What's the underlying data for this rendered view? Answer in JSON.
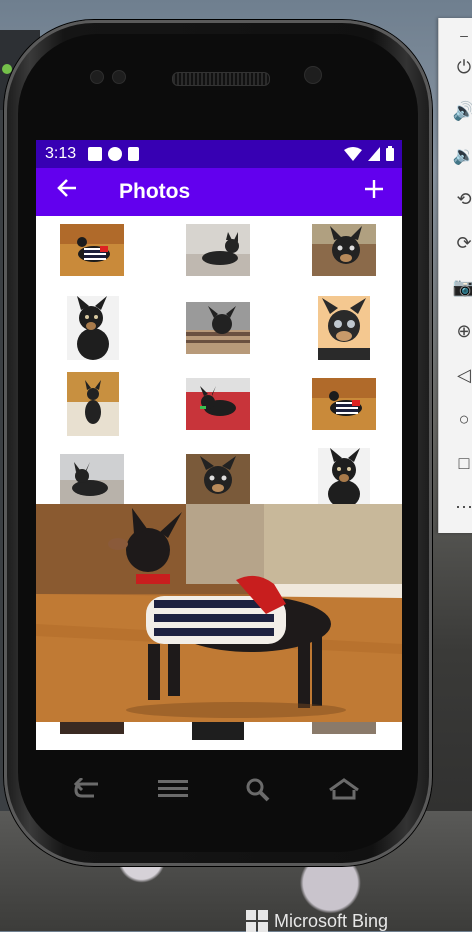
{
  "status_bar": {
    "time": "3:13"
  },
  "app_bar": {
    "back_icon": "arrow-back-icon",
    "title": "Photos",
    "add_icon": "add-icon"
  },
  "colors": {
    "status_bar": "#3700b3",
    "app_bar": "#6200ee",
    "toolbar": "#f3f3f3"
  },
  "photos": [
    {
      "alt": "dog-striped-shirt"
    },
    {
      "alt": "dog-lying-couch"
    },
    {
      "alt": "dog-close-up-dark"
    },
    {
      "alt": "dog-sitting-white"
    },
    {
      "alt": "dog-in-bed"
    },
    {
      "alt": "dog-face-close-up"
    },
    {
      "alt": "dog-standing-floor"
    },
    {
      "alt": "dog-on-red-blanket"
    },
    {
      "alt": "dog-striped-shirt-2"
    },
    {
      "alt": "dog-lying-blanket"
    },
    {
      "alt": "dog-close-up-light"
    },
    {
      "alt": "dog-sitting-sweater"
    }
  ],
  "emulator_toolbar": [
    "power-icon",
    "volume-up-icon",
    "volume-down-icon",
    "rotate-left-icon",
    "rotate-right-icon",
    "camera-icon",
    "zoom-icon",
    "back-icon",
    "home-icon",
    "overview-icon",
    "more-icon"
  ],
  "watermark": "Microsoft Bing"
}
